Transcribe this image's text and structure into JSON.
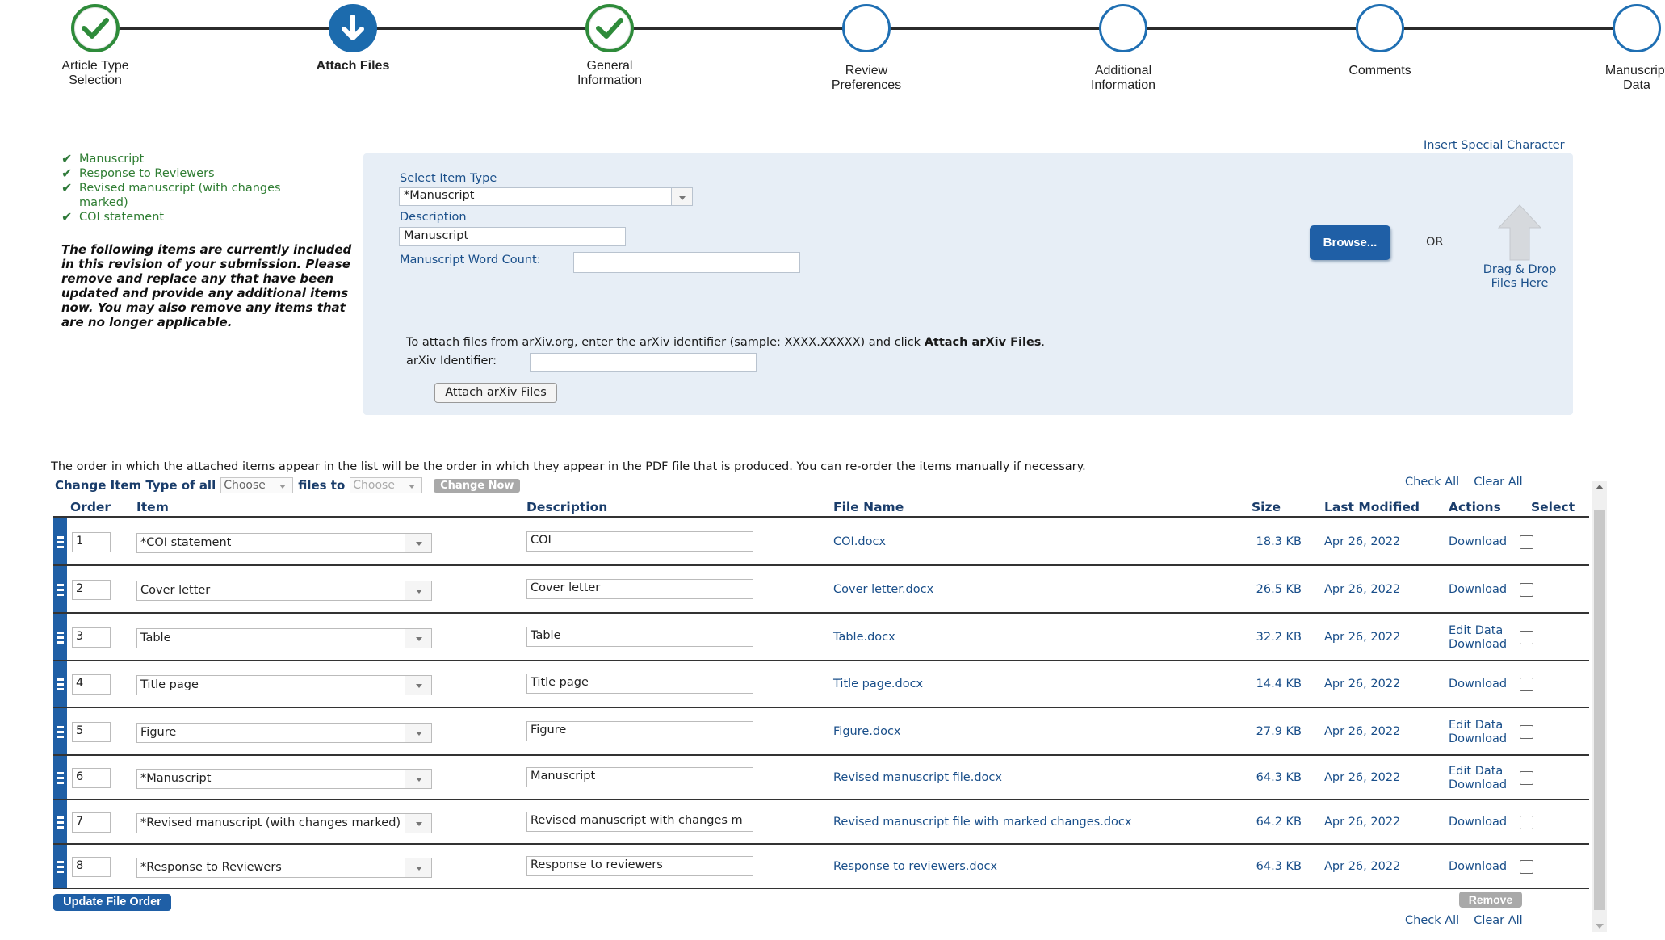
{
  "steps": [
    {
      "label": "Article Type Selection",
      "state": "done"
    },
    {
      "label": "Attach Files",
      "state": "current"
    },
    {
      "label": "General Information",
      "state": "done"
    },
    {
      "label": "Review Preferences",
      "state": "pending"
    },
    {
      "label": "Additional Information",
      "state": "pending"
    },
    {
      "label": "Comments",
      "state": "pending"
    },
    {
      "label": "Manuscript Data",
      "state": "pending"
    }
  ],
  "checklist": [
    "Manuscript",
    "Response to Reviewers",
    "Revised manuscript (with changes marked)",
    "COI statement"
  ],
  "instructions": "The following items are currently included in this revision of your submission. Please remove and replace any that have been updated and provide any additional items now. You may also remove any items that are no longer applicable.",
  "upload": {
    "insert_special_char": "Insert Special Character",
    "select_item_type_label": "Select Item Type",
    "select_item_type_value": "*Manuscript",
    "description_label": "Description",
    "description_value": "Manuscript",
    "word_count_label": "Manuscript Word Count:",
    "word_count_value": "",
    "browse_label": "Browse...",
    "or_label": "OR",
    "drag_drop_line1": "Drag & Drop",
    "drag_drop_line2": "Files Here",
    "arxiv_note_prefix": "To attach files from arXiv.org, enter the arXiv identifier (sample: XXXX.XXXXX) and click ",
    "arxiv_note_bold": "Attach arXiv Files",
    "arxiv_note_suffix": ".",
    "arxiv_id_label": "arXiv Identifier:",
    "arxiv_id_value": "",
    "arxiv_button": "Attach arXiv Files"
  },
  "files": {
    "order_note": "The order in which the attached items appear in the list will be the order in which they appear in the PDF file that is produced. You can re-order the items manually if necessary.",
    "change_type_label": "Change Item Type of all",
    "change_from_value": "Choose",
    "files_to_label": "files to",
    "change_to_value": "Choose",
    "change_now": "Change Now",
    "check_all": "Check All",
    "clear_all": "Clear All",
    "headers": {
      "order": "Order",
      "item": "Item",
      "description": "Description",
      "file_name": "File Name",
      "size": "Size",
      "last_modified": "Last Modified",
      "actions": "Actions",
      "select": "Select"
    },
    "rows": [
      {
        "order": "1",
        "item": "*COI statement",
        "description": "COI",
        "file_name": "COI.docx",
        "size": "18.3 KB",
        "modified": "Apr 26, 2022",
        "actions": [
          "Download"
        ]
      },
      {
        "order": "2",
        "item": "Cover letter",
        "description": "Cover letter",
        "file_name": "Cover letter.docx",
        "size": "26.5 KB",
        "modified": "Apr 26, 2022",
        "actions": [
          "Download"
        ]
      },
      {
        "order": "3",
        "item": "Table",
        "description": "Table",
        "file_name": "Table.docx",
        "size": "32.2 KB",
        "modified": "Apr 26, 2022",
        "actions": [
          "Edit Data",
          "Download"
        ]
      },
      {
        "order": "4",
        "item": "Title page",
        "description": "Title page",
        "file_name": "Title page.docx",
        "size": "14.4 KB",
        "modified": "Apr 26, 2022",
        "actions": [
          "Download"
        ]
      },
      {
        "order": "5",
        "item": "Figure",
        "description": "Figure",
        "file_name": "Figure.docx",
        "size": "27.9 KB",
        "modified": "Apr 26, 2022",
        "actions": [
          "Edit Data",
          "Download"
        ]
      },
      {
        "order": "6",
        "item": "*Manuscript",
        "description": "Manuscript",
        "file_name": "Revised manuscript file.docx",
        "size": "64.3 KB",
        "modified": "Apr 26, 2022",
        "actions": [
          "Edit Data",
          "Download"
        ]
      },
      {
        "order": "7",
        "item": "*Revised manuscript (with changes marked)",
        "description": "Revised manuscript with changes m",
        "file_name": "Revised manuscript file with marked changes.docx",
        "size": "64.2 KB",
        "modified": "Apr 26, 2022",
        "actions": [
          "Download"
        ]
      },
      {
        "order": "8",
        "item": "*Response to Reviewers",
        "description": "Response to reviewers",
        "file_name": "Response to reviewers.docx",
        "size": "64.3 KB",
        "modified": "Apr 26, 2022",
        "actions": [
          "Download"
        ]
      }
    ],
    "update_order": "Update File Order",
    "remove": "Remove"
  },
  "colors": {
    "done_green": "#2e8b3a",
    "current_blue": "#1c6bad",
    "link_blue": "#1a4f8a",
    "panel_bg": "#e7eef6"
  }
}
